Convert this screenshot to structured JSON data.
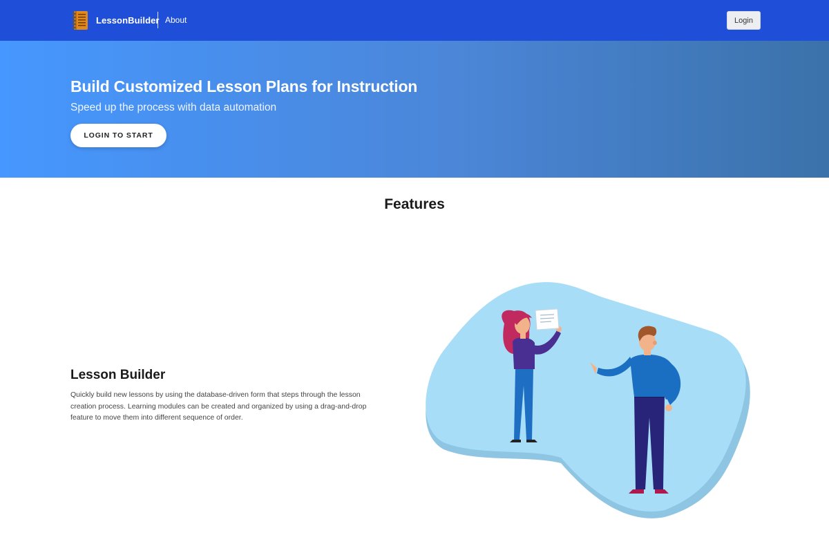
{
  "navbar": {
    "brand_icon": "notebook-icon",
    "brand_name": "LessonBuilder",
    "about_link": "About",
    "login_button": "Login",
    "color": "#1f4fd8"
  },
  "hero": {
    "title": "Build Customized Lesson Plans for Instruction",
    "subtitle": "Speed up the process with data automation",
    "cta_button": "LOGIN TO START",
    "gradient": [
      "#4697ff",
      "#3b72aa"
    ]
  },
  "features": {
    "heading": "Features",
    "items": [
      {
        "title": "Lesson Builder",
        "description": "Quickly build new lessons by using the database-driven form that steps through the lesson creation process. Learning modules can be created and organized by using a drag-and-drop feature to move them into different sequence of order.",
        "illustration": "two-people-presenting-illustration"
      }
    ]
  }
}
